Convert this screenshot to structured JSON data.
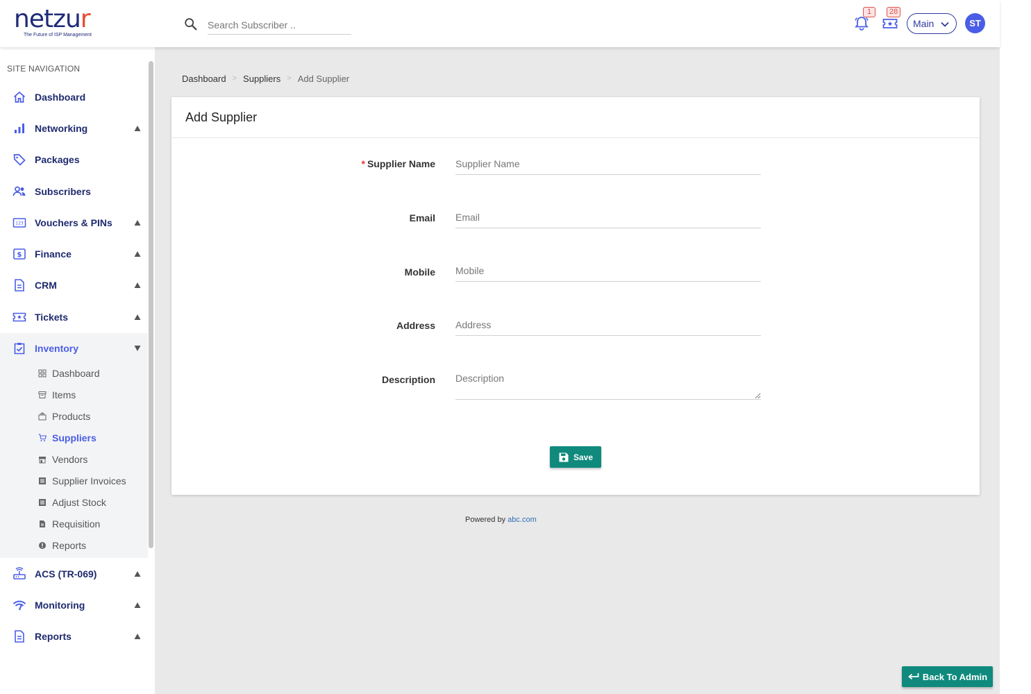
{
  "brand": {
    "name_main": "netzu",
    "name_accent": "r",
    "tagline": "The Future of ISP Management"
  },
  "search": {
    "placeholder": "Search Subscriber .."
  },
  "header": {
    "notifications_count": "1",
    "tickets_count": "28",
    "workspace_label": "Main",
    "avatar_initials": "ST"
  },
  "sidebar": {
    "title": "SITE NAVIGATION",
    "items": [
      {
        "label": "Dashboard"
      },
      {
        "label": "Networking"
      },
      {
        "label": "Packages"
      },
      {
        "label": "Subscribers"
      },
      {
        "label": "Vouchers & PINs"
      },
      {
        "label": "Finance"
      },
      {
        "label": "CRM"
      },
      {
        "label": "Tickets"
      },
      {
        "label": "Inventory"
      },
      {
        "label": "ACS (TR-069)"
      },
      {
        "label": "Monitoring"
      },
      {
        "label": "Reports"
      }
    ],
    "inventory_sub": [
      {
        "label": "Dashboard"
      },
      {
        "label": "Items"
      },
      {
        "label": "Products"
      },
      {
        "label": "Suppliers"
      },
      {
        "label": "Vendors"
      },
      {
        "label": "Supplier Invoices"
      },
      {
        "label": "Adjust Stock"
      },
      {
        "label": "Requisition"
      },
      {
        "label": "Reports"
      }
    ]
  },
  "breadcrumb": {
    "home": "Dashboard",
    "parent": "Suppliers",
    "current": "Add Supplier"
  },
  "form": {
    "title": "Add Supplier",
    "required_mark": "*",
    "fields": {
      "supplier_name": {
        "label": "Supplier Name",
        "placeholder": "Supplier Name"
      },
      "email": {
        "label": "Email",
        "placeholder": "Email"
      },
      "mobile": {
        "label": "Mobile",
        "placeholder": "Mobile"
      },
      "address": {
        "label": "Address",
        "placeholder": "Address"
      },
      "description": {
        "label": "Description",
        "placeholder": "Description"
      }
    },
    "save_label": "Save"
  },
  "footer": {
    "powered_by": "Powered by",
    "link_text": "abc.com"
  },
  "back_button": {
    "label": "Back To Admin"
  },
  "colors": {
    "brand_navy": "#1e2a6e",
    "accent_blue": "#4a5de6",
    "teal": "#0f8a7d",
    "logo_orange": "#e84a2e",
    "badge_red": "#d9534f"
  }
}
